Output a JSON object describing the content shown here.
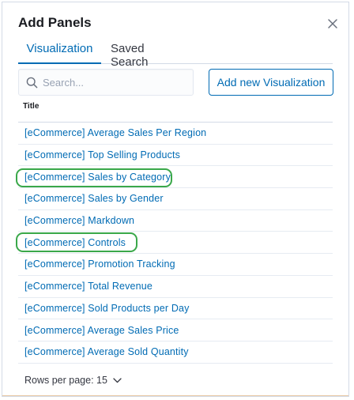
{
  "flyout": {
    "title": "Add Panels",
    "tabs": [
      {
        "label": "Visualization",
        "active": true
      },
      {
        "label": "Saved Search",
        "active": false
      }
    ],
    "search": {
      "placeholder": "Search...",
      "value": ""
    },
    "add_button_label": "Add new Visualization",
    "table": {
      "column_header": "Title",
      "rows": [
        "[eCommerce] Average Sales Per Region",
        "[eCommerce] Top Selling Products",
        "[eCommerce] Sales by Category",
        "[eCommerce] Sales by Gender",
        "[eCommerce] Markdown",
        "[eCommerce] Controls",
        "[eCommerce] Promotion Tracking",
        "[eCommerce] Total Revenue",
        "[eCommerce] Sold Products per Day",
        "[eCommerce] Average Sales Price",
        "[eCommerce] Average Sold Quantity"
      ],
      "highlighted_rows": [
        "[eCommerce] Sales by Category",
        "[eCommerce] Controls"
      ]
    },
    "pagination": {
      "label": "Rows per page: 15"
    }
  },
  "icons": {
    "close": "close-icon",
    "search": "search-icon",
    "chevron": "chevron-down-icon"
  },
  "colors": {
    "accent": "#006bb4",
    "highlight": "#3aa84a",
    "border": "#d3dae6"
  }
}
